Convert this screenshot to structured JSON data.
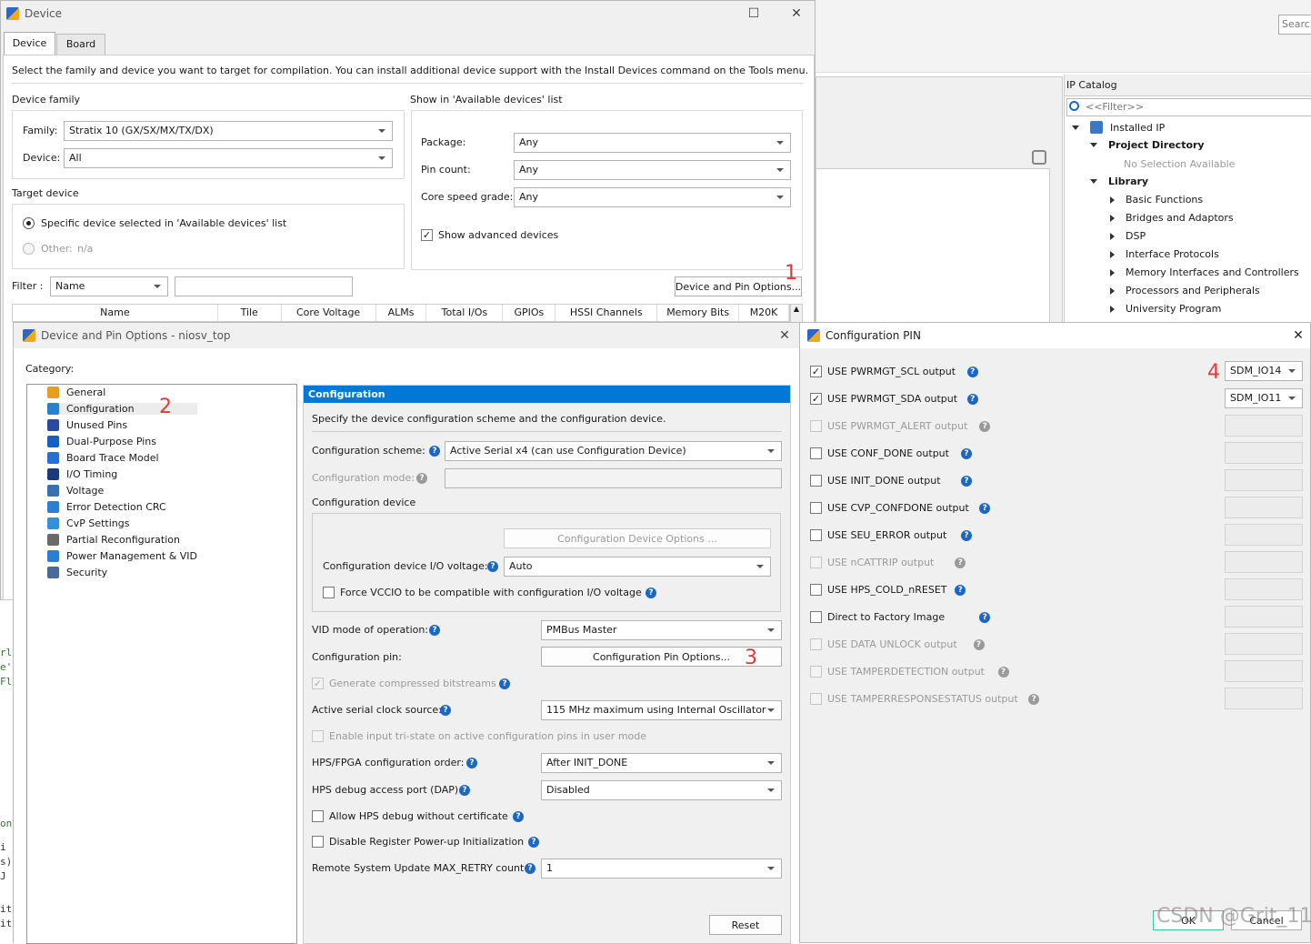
{
  "bg": {
    "search_placeholder": "Search",
    "ip_catalog": {
      "title": "IP Catalog",
      "filter": "<<Filter>>",
      "root": "Installed IP",
      "project_dir": "Project Directory",
      "no_sel": "No Selection Available",
      "library": "Library",
      "items": [
        "Basic Functions",
        "Bridges and Adaptors",
        "DSP",
        "Interface Protocols",
        "Memory Interfaces and Controllers",
        "Processors and Peripherals",
        "University Program"
      ]
    }
  },
  "device": {
    "title": "Device",
    "tabs": [
      "Device",
      "Board"
    ],
    "intro": "Select the family and device you want to target for compilation. You can install additional device support with the Install Devices command on the Tools menu.",
    "family_group": "Device family",
    "family_label": "Family:",
    "family_value": "Stratix 10 (GX/SX/MX/TX/DX)",
    "device_label": "Device:",
    "device_value": "All",
    "target_group": "Target device",
    "radio_specific": "Specific device selected in 'Available devices' list",
    "radio_other": "Other:",
    "other_value": "n/a",
    "show_group": "Show in 'Available devices' list",
    "package_label": "Package:",
    "package_value": "Any",
    "pincount_label": "Pin count:",
    "pincount_value": "Any",
    "speed_label": "Core speed grade:",
    "speed_value": "Any",
    "show_adv": "Show advanced devices",
    "filter_label": "Filter :",
    "filter_value": "Name",
    "pin_options_btn": "Device and Pin Options...",
    "columns": [
      "Name",
      "Tile",
      "Core Voltage",
      "ALMs",
      "Total I/Os",
      "GPIOs",
      "HSSI Channels",
      "Memory Bits",
      "M20K"
    ]
  },
  "dpo": {
    "title": "Device and Pin Options - niosv_top",
    "category_label": "Category:",
    "categories": [
      "General",
      "Configuration",
      "Unused Pins",
      "Dual-Purpose Pins",
      "Board Trace Model",
      "I/O Timing",
      "Voltage",
      "Error Detection CRC",
      "CvP Settings",
      "Partial Reconfiguration",
      "Power Management & VID",
      "Security"
    ],
    "panel_title": "Configuration",
    "panel_desc": "Specify the device configuration scheme and the configuration device.",
    "scheme_label": "Configuration scheme:",
    "scheme_value": "Active Serial x4 (can use Configuration Device)",
    "mode_label": "Configuration mode:",
    "device_group": "Configuration device",
    "dev_opts_btn": "Configuration Device Options ...",
    "io_voltage_label": "Configuration device I/O voltage:",
    "io_voltage_value": "Auto",
    "force_vccio": "Force VCCIO to be compatible with configuration I/O voltage",
    "vid_label": "VID mode of operation:",
    "vid_value": "PMBus Master",
    "pin_label": "Configuration pin:",
    "pin_btn": "Configuration Pin Options...",
    "gen_compressed": "Generate compressed bitstreams",
    "clock_label": "Active serial clock source:",
    "clock_value": "115 MHz maximum using Internal Oscillator",
    "tristate": "Enable input tri-state on active configuration pins in user mode",
    "order_label": "HPS/FPGA configuration order:",
    "order_value": "After INIT_DONE",
    "dap_label": "HPS debug access port (DAP):",
    "dap_value": "Disabled",
    "allow_hps": "Allow HPS debug without certificate",
    "disable_reg": "Disable Register Power-up Initialization",
    "retry_label": "Remote System Update MAX_RETRY count",
    "retry_value": "1",
    "reset_btn": "Reset"
  },
  "cfgpin": {
    "title": "Configuration PIN",
    "rows": [
      {
        "label": "USE PWRMGT_SCL output",
        "checked": true,
        "enabled": true,
        "value": "SDM_IO14"
      },
      {
        "label": "USE PWRMGT_SDA output",
        "checked": true,
        "enabled": true,
        "value": "SDM_IO11"
      },
      {
        "label": "USE PWRMGT_ALERT output",
        "checked": false,
        "enabled": false,
        "value": ""
      },
      {
        "label": "USE CONF_DONE output",
        "checked": false,
        "enabled": true,
        "value": ""
      },
      {
        "label": "USE INIT_DONE output",
        "checked": false,
        "enabled": true,
        "value": ""
      },
      {
        "label": "USE CVP_CONFDONE output",
        "checked": false,
        "enabled": true,
        "value": ""
      },
      {
        "label": "USE SEU_ERROR output",
        "checked": false,
        "enabled": true,
        "value": ""
      },
      {
        "label": "USE nCATTRIP output",
        "checked": false,
        "enabled": false,
        "value": ""
      },
      {
        "label": "USE HPS_COLD_nRESET",
        "checked": false,
        "enabled": true,
        "value": ""
      },
      {
        "label": "Direct to Factory Image",
        "checked": false,
        "enabled": true,
        "value": ""
      },
      {
        "label": "USE DATA UNLOCK output",
        "checked": false,
        "enabled": false,
        "value": ""
      },
      {
        "label": "USE TAMPERDETECTION output",
        "checked": false,
        "enabled": false,
        "value": ""
      },
      {
        "label": "USE TAMPERRESPONSESTATUS output",
        "checked": false,
        "enabled": false,
        "value": ""
      }
    ],
    "ok": "OK",
    "cancel": "Cancel"
  },
  "annotations": [
    "1",
    "2",
    "3",
    "4"
  ],
  "watermark": "CSDN @Grit_11"
}
